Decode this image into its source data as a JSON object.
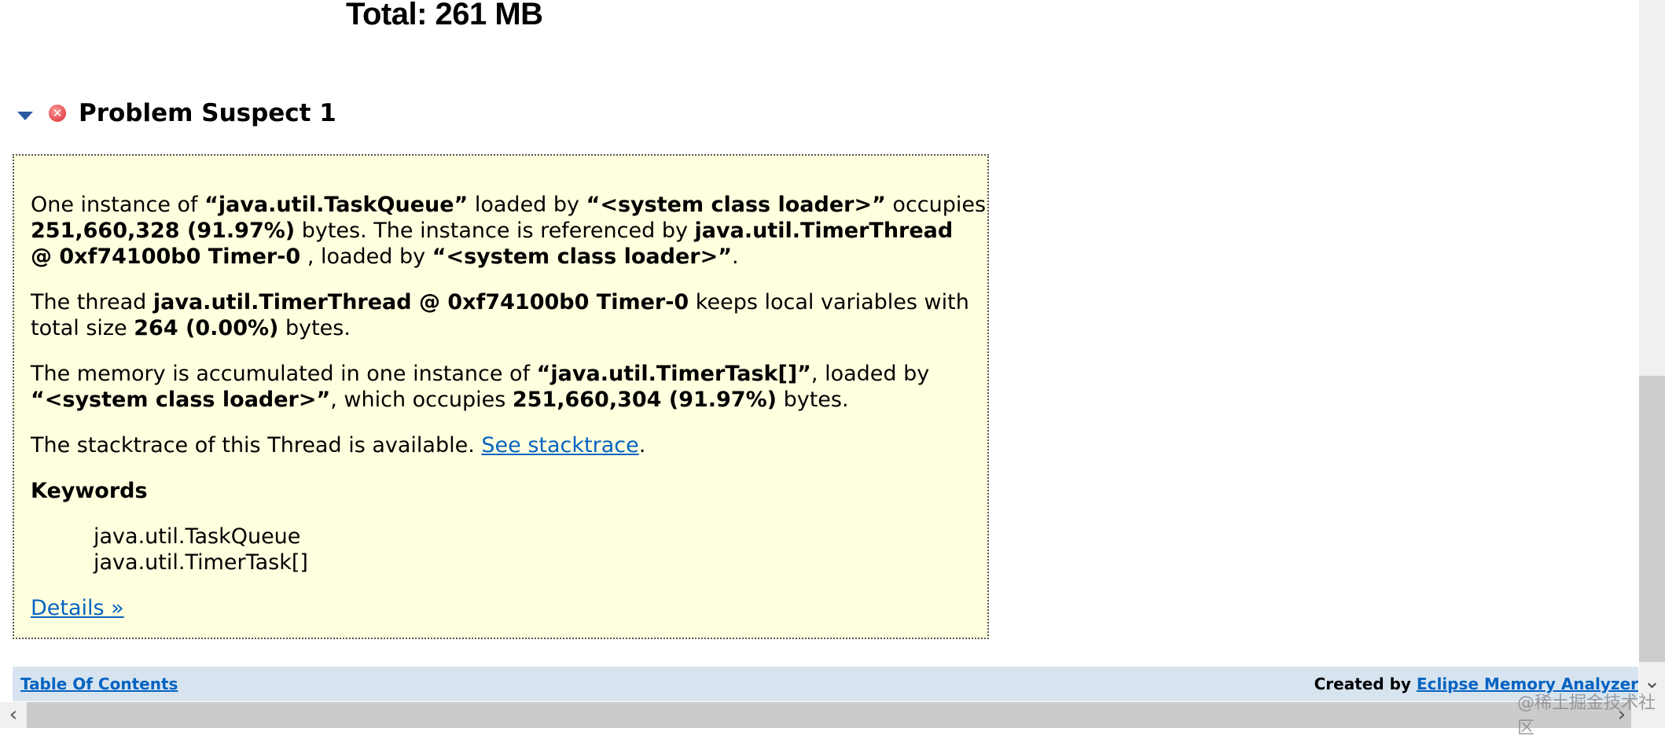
{
  "total": "Total: 261 MB",
  "suspect": {
    "title": "Problem Suspect 1",
    "p1": [
      "One instance of ",
      "“java.util.TaskQueue”",
      " loaded by ",
      "“<system class loader>”",
      " occupies",
      "251,660,328 (91.97%)",
      " bytes. The instance is referenced by ",
      "java.util.TimerThread",
      "@ 0xf74100b0 Timer-0",
      " , loaded by ",
      "“<system class loader>”",
      "."
    ],
    "p2": [
      "The thread ",
      "java.util.TimerThread @ 0xf74100b0 Timer-0",
      " keeps local variables with",
      "total size ",
      "264 (0.00%)",
      " bytes."
    ],
    "p3": [
      "The memory is accumulated in one instance of ",
      "“java.util.TimerTask[]”",
      ", loaded by",
      "“<system class loader>”",
      ", which occupies ",
      "251,660,304 (91.97%)",
      " bytes."
    ],
    "p4": [
      "The stacktrace of this Thread is available. ",
      "See stacktrace",
      "."
    ],
    "keywords_heading": "Keywords",
    "keywords": [
      "java.util.TaskQueue",
      "java.util.TimerTask[]"
    ],
    "details_link": "Details »"
  },
  "footer": {
    "toc_link": "Table Of Contents",
    "created_by": "Created by ",
    "analyzer_link": "Eclipse Memory Analyzer"
  },
  "watermark": "@稀土掘金技术社区",
  "colors": {
    "box_bg": "#ffffdf",
    "link": "#0563c1",
    "footer_bg": "#d7e4f0",
    "error": "#d9262c"
  },
  "icons": {
    "collapse": "triangle-down-icon",
    "error": "error-circle-icon"
  }
}
